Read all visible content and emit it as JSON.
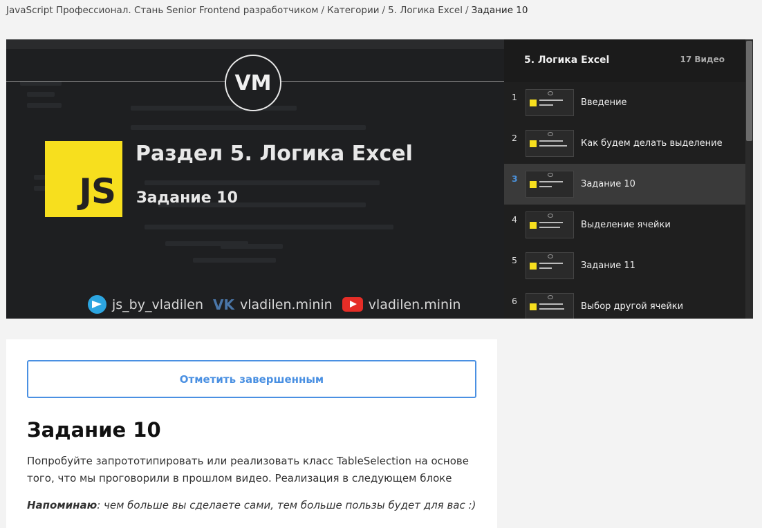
{
  "breadcrumb": {
    "items": [
      "JavaScript Профессионал. Стань Senior Frontend разработчиком",
      "Категории",
      "5. Логика Excel"
    ],
    "current": "Задание 10",
    "separator": "/"
  },
  "video": {
    "logo_text": "VM",
    "js_badge": "JS",
    "title": "Раздел 5. Логика Excel",
    "subtitle": "Задание 10",
    "socials": {
      "telegram": "js_by_vladilen",
      "vk": "vladilen.minin",
      "youtube": "vladilen.minin"
    }
  },
  "playlist": {
    "title": "5. Логика Excel",
    "count": "17 Видео",
    "items": [
      {
        "num": "1",
        "label": "Введение"
      },
      {
        "num": "2",
        "label": "Как будем делать выделение"
      },
      {
        "num": "3",
        "label": "Задание 10"
      },
      {
        "num": "4",
        "label": "Выделение ячейки"
      },
      {
        "num": "5",
        "label": "Задание 11"
      },
      {
        "num": "6",
        "label": "Выбор другой ячейки"
      }
    ],
    "active_index": 2
  },
  "lesson": {
    "complete_button": "Отметить завершенным",
    "title": "Задание 10",
    "text": "Попробуйте запрототипировать или реализовать класс TableSelection на основе того, что мы проговорили в прошлом видео. Реализация в следующем блоке",
    "reminder_label": "Напоминаю",
    "reminder_text": ": чем больше вы сделаете сами, тем больше пользы будет для вас :)"
  },
  "colors": {
    "accent": "#4a90e2",
    "js_yellow": "#f7df1e",
    "active_number": "#4a90d9"
  }
}
